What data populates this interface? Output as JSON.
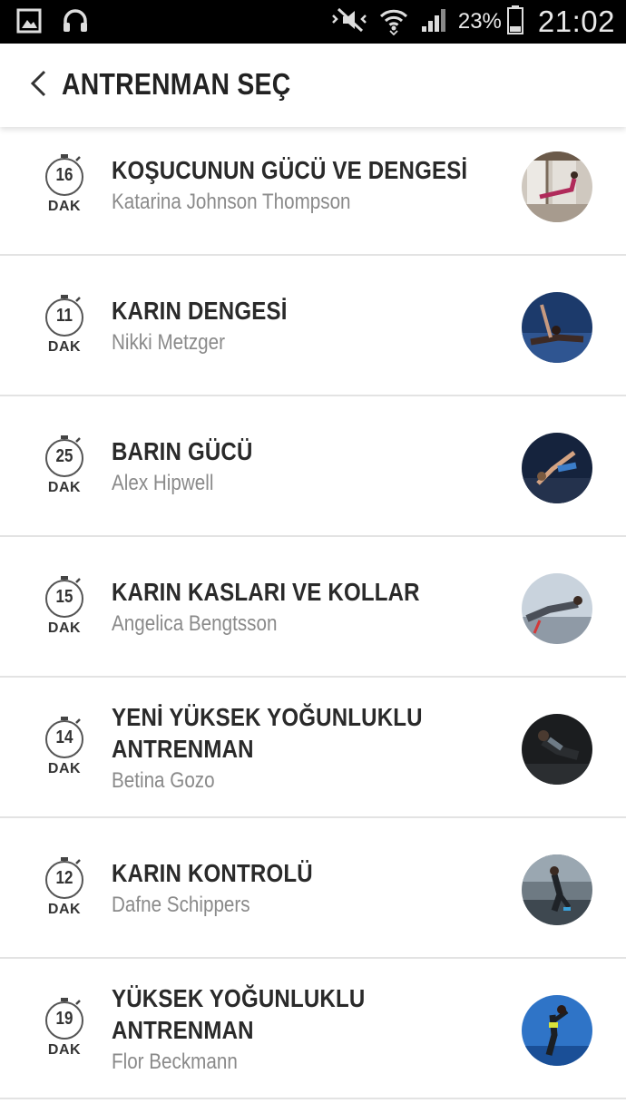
{
  "status_bar": {
    "battery_percent": "23%",
    "time": "21:02"
  },
  "header": {
    "title": "ANTRENMAN SEÇ"
  },
  "workouts": [
    {
      "minutes": "16",
      "unit": "DAK",
      "title": "KOŞUCUNUN GÜCÜ VE DENGESİ",
      "trainer": "Katarina Johnson Thompson"
    },
    {
      "minutes": "11",
      "unit": "DAK",
      "title": "KARIN DENGESİ",
      "trainer": "Nikki Metzger"
    },
    {
      "minutes": "25",
      "unit": "DAK",
      "title": "BARIN GÜCÜ",
      "trainer": "Alex Hipwell"
    },
    {
      "minutes": "15",
      "unit": "DAK",
      "title": "KARIN KASLARI VE KOLLAR",
      "trainer": "Angelica Bengtsson"
    },
    {
      "minutes": "14",
      "unit": "DAK",
      "title": "YENİ YÜKSEK YOĞUNLUKLU ANTRENMAN",
      "trainer": "Betina Gozo"
    },
    {
      "minutes": "12",
      "unit": "DAK",
      "title": "KARIN KONTROLÜ",
      "trainer": "Dafne Schippers"
    },
    {
      "minutes": "19",
      "unit": "DAK",
      "title": "YÜKSEK YOĞUNLUKLU ANTRENMAN",
      "trainer": "Flor Beckmann"
    }
  ]
}
